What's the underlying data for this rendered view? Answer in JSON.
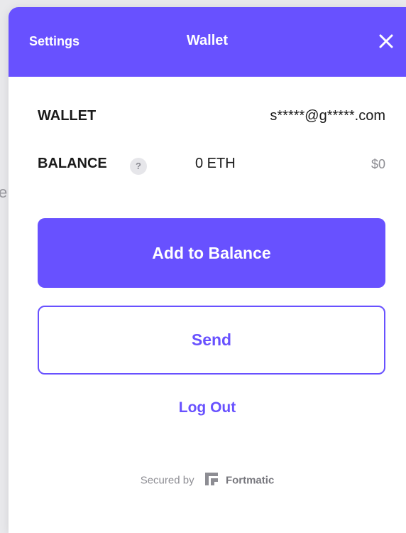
{
  "background": {
    "partial_text": "e"
  },
  "header": {
    "settings_label": "Settings",
    "title": "Wallet",
    "close_icon": "close-icon"
  },
  "wallet": {
    "label": "WALLET",
    "email": "s*****@g*****.com"
  },
  "balance": {
    "label": "BALANCE",
    "help": "?",
    "eth": "0 ETH",
    "usd": "$0"
  },
  "actions": {
    "add_balance": "Add to Balance",
    "send": "Send",
    "logout": "Log Out"
  },
  "footer": {
    "secured_by": "Secured by",
    "brand": "Fortmatic",
    "logo_icon": "fortmatic-logo"
  },
  "colors": {
    "accent": "#6851ff",
    "muted": "#8d8d93"
  }
}
